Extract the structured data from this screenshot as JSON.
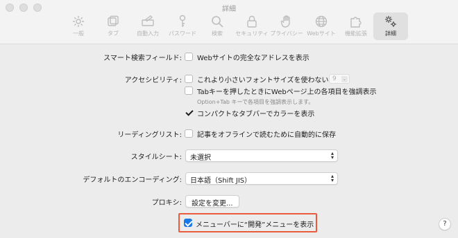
{
  "window": {
    "title": "詳細"
  },
  "toolbar": {
    "items": [
      {
        "label": "一般",
        "icon": "gear-icon"
      },
      {
        "label": "タブ",
        "icon": "tabs-icon"
      },
      {
        "label": "自動入力",
        "icon": "autofill-icon"
      },
      {
        "label": "パスワード",
        "icon": "key-icon"
      },
      {
        "label": "検索",
        "icon": "search-icon"
      },
      {
        "label": "セキュリティ",
        "icon": "lock-icon"
      },
      {
        "label": "プライバシー",
        "icon": "hand-icon"
      },
      {
        "label": "Webサイト",
        "icon": "globe-icon"
      },
      {
        "label": "機能拡張",
        "icon": "puzzle-icon"
      },
      {
        "label": "詳細",
        "icon": "gears-icon",
        "selected": true
      }
    ]
  },
  "settings": {
    "smart_search": {
      "label": "スマート検索フィールド:",
      "option": "Webサイトの完全なアドレスを表示",
      "checked": false
    },
    "accessibility": {
      "label": "アクセシビリティ:",
      "font_option": "これより小さいフォントサイズを使わない:",
      "font_size": "9",
      "font_checked": false,
      "tab_option": "Tabキーを押したときにWebページ上の各項目を強調表示",
      "tab_checked": false,
      "tab_hint": "Option+Tab キーで各項目を強調表示します。",
      "compact_option": "コンパクトなタブバーでカラーを表示",
      "compact_checked": true
    },
    "reading_list": {
      "label": "リーディングリスト:",
      "option": "記事をオフラインで読むために自動的に保存",
      "checked": false
    },
    "stylesheet": {
      "label": "スタイルシート:",
      "value": "未選択"
    },
    "encoding": {
      "label": "デフォルトのエンコーディング:",
      "value": "日本語（Shift JIS）"
    },
    "proxy": {
      "label": "プロキシ:",
      "button": "設定を変更..."
    },
    "develop_menu": {
      "option": "メニューバーに“開発”メニューを表示",
      "checked": true
    }
  },
  "help": {
    "label": "?"
  },
  "colors": {
    "highlight": "#ec5a3c",
    "checkbox_accent": "#1a78e6"
  }
}
